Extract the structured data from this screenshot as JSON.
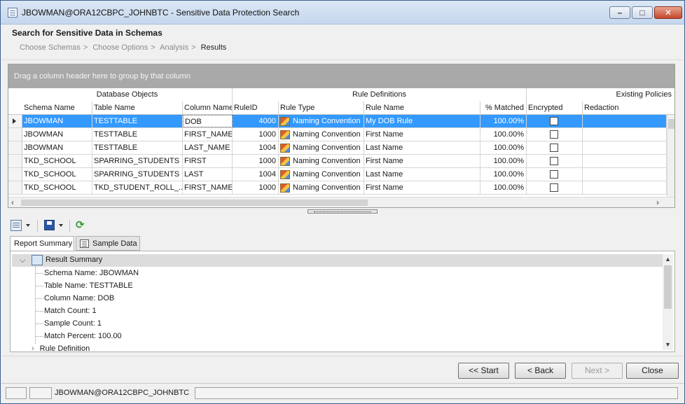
{
  "window": {
    "title": "JBOWMAN@ORA12CBPC_JOHNBTC - Sensitive Data Protection Search",
    "controls": {
      "minimize": "–",
      "maximize": "□",
      "close": "✕"
    }
  },
  "header": {
    "title": "Search for Sensitive Data in Schemas",
    "breadcrumb": [
      {
        "label": "Choose Schemas"
      },
      {
        "label": "Choose Options"
      },
      {
        "label": "Analysis"
      },
      {
        "label": "Results"
      }
    ],
    "separator": ">"
  },
  "grid": {
    "group_hint": "Drag a column header here to group by that column",
    "bands": [
      "Database Objects",
      "Rule Definitions",
      "Existing Policies"
    ],
    "columns": [
      "Schema Name",
      "Table Name",
      "Column Name",
      "RuleID",
      "Rule Type",
      "Rule Name",
      "% Matched",
      "Encrypted",
      "Redaction"
    ],
    "rows": [
      {
        "schema": "JBOWMAN",
        "table": "TESTTABLE",
        "column": "DOB",
        "rule_id": "4000",
        "rule_type": "Naming Convention",
        "rule_name": "My DOB Rule",
        "matched": "100.00%",
        "encrypted": false,
        "redaction": ""
      },
      {
        "schema": "JBOWMAN",
        "table": "TESTTABLE",
        "column": "FIRST_NAME",
        "rule_id": "1000",
        "rule_type": "Naming Convention",
        "rule_name": "First Name",
        "matched": "100.00%",
        "encrypted": false,
        "redaction": ""
      },
      {
        "schema": "JBOWMAN",
        "table": "TESTTABLE",
        "column": "LAST_NAME",
        "rule_id": "1004",
        "rule_type": "Naming Convention",
        "rule_name": "Last Name",
        "matched": "100.00%",
        "encrypted": false,
        "redaction": ""
      },
      {
        "schema": "TKD_SCHOOL",
        "table": "SPARRING_STUDENTS",
        "column": "FIRST",
        "rule_id": "1000",
        "rule_type": "Naming Convention",
        "rule_name": "First Name",
        "matched": "100.00%",
        "encrypted": false,
        "redaction": ""
      },
      {
        "schema": "TKD_SCHOOL",
        "table": "SPARRING_STUDENTS",
        "column": "LAST",
        "rule_id": "1004",
        "rule_type": "Naming Convention",
        "rule_name": "Last Name",
        "matched": "100.00%",
        "encrypted": false,
        "redaction": ""
      },
      {
        "schema": "TKD_SCHOOL",
        "table": "TKD_STUDENT_ROLL_...",
        "column": "FIRST_NAME",
        "rule_id": "1000",
        "rule_type": "Naming Convention",
        "rule_name": "First Name",
        "matched": "100.00%",
        "encrypted": false,
        "redaction": ""
      }
    ],
    "selected_row": 0
  },
  "tabs": [
    "Report Summary",
    "Sample Data"
  ],
  "summary": {
    "heading": "Result Summary",
    "items": [
      "Schema Name: JBOWMAN",
      "Table Name: TESTTABLE",
      "Column Name: DOB",
      "Match Count: 1",
      "Sample Count: 1",
      "Match Percent: 100.00"
    ],
    "next_section": "Rule Definition"
  },
  "buttons": {
    "start": "<< Start",
    "back": "< Back",
    "next": "Next >",
    "close": "Close"
  },
  "status": {
    "connection": "JBOWMAN@ORA12CBPC_JOHNBTC"
  }
}
